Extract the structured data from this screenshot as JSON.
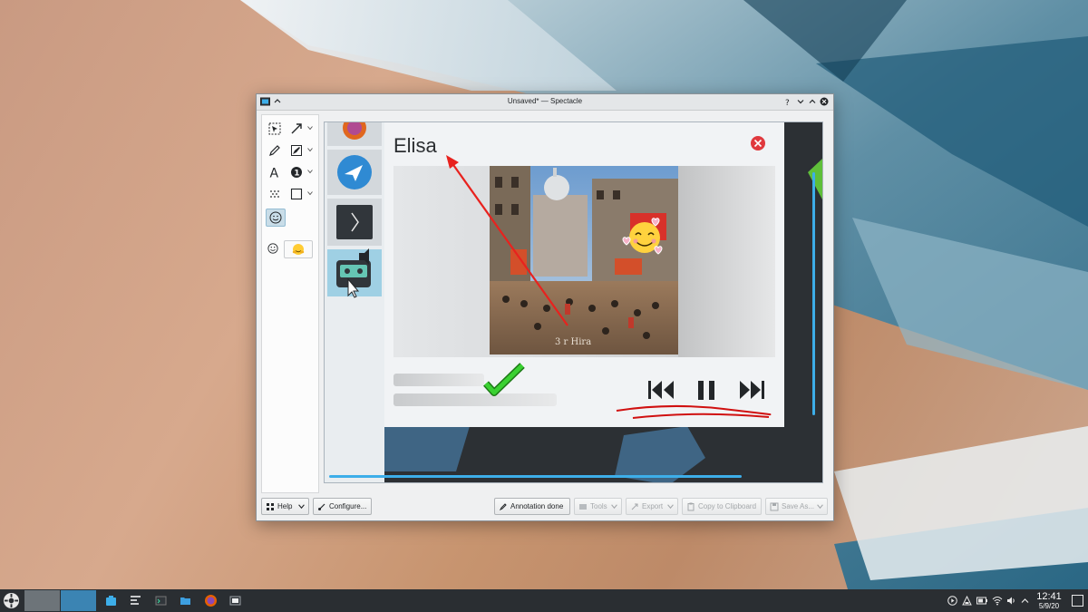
{
  "window": {
    "title": "Unsaved* — Spectacle"
  },
  "titlebar_buttons": [
    "help-icon",
    "minimize-icon",
    "maximize-icon",
    "close-icon"
  ],
  "tools": [
    {
      "name": "select-tool",
      "icon": "selection-icon"
    },
    {
      "name": "arrow-tool",
      "icon": "arrow-icon"
    },
    {
      "name": "pen-tool",
      "icon": "pencil-icon"
    },
    {
      "name": "highlighter-tool",
      "icon": "highlighter-icon"
    },
    {
      "name": "text-tool",
      "icon": "text-icon",
      "glyph": "A"
    },
    {
      "name": "number-tool",
      "icon": "number-icon",
      "glyph": "1"
    },
    {
      "name": "blur-tool",
      "icon": "blur-icon"
    },
    {
      "name": "rectangle-tool",
      "icon": "rectangle-icon"
    },
    {
      "name": "emoji-tool",
      "icon": "emoji-icon"
    }
  ],
  "screenshot": {
    "app_title": "Elisa",
    "album_caption": "3 r Hira",
    "colors": {
      "accent": "#3daee9",
      "arrow": "#e8221e",
      "check": "#27c51f",
      "underline": "#d01010"
    }
  },
  "bottom_buttons": {
    "help": "Help",
    "configure": "Configure...",
    "annotation_done": "Annotation done",
    "tools": "Tools",
    "export": "Export",
    "copy": "Copy to Clipboard",
    "save_as": "Save As..."
  },
  "taskbar": {
    "time": "12:41",
    "date": "5/9/20"
  }
}
